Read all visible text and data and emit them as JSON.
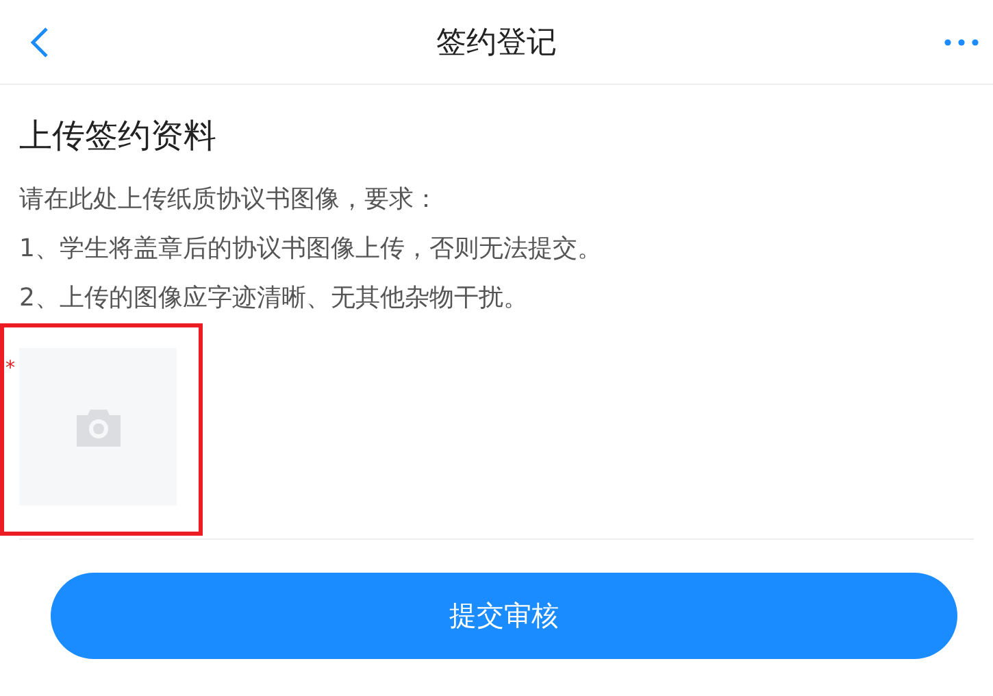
{
  "header": {
    "title": "签约登记"
  },
  "section": {
    "title": "上传签约资料",
    "instructions": [
      "请在此处上传纸质协议书图像，要求：",
      "1、学生将盖章后的协议书图像上传，否则无法提交。",
      "2、上传的图像应字迹清晰、无其他杂物干扰。"
    ]
  },
  "upload": {
    "required_mark": "*"
  },
  "submit_button": {
    "label": "提交审核"
  }
}
